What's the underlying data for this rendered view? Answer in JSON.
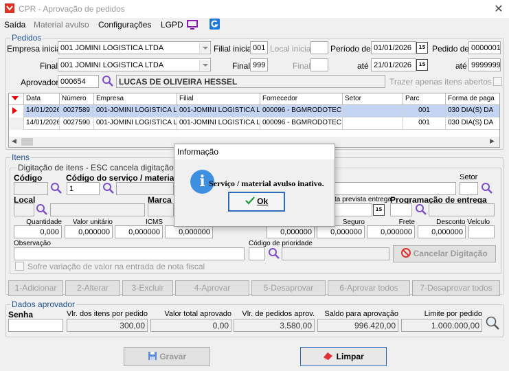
{
  "window": {
    "title": "CPR - Aprovação de pedidos"
  },
  "menu": {
    "items": [
      "Saída",
      "Material avulso",
      "Configurações",
      "LGPD"
    ]
  },
  "pedidos": {
    "group_label": "Pedidos",
    "empresa_inicial_label": "Empresa inicial",
    "empresa_inicial_value": "001 JOMINI LOGISTICA LTDA",
    "filial_inicial_label": "Filial inicial",
    "filial_inicial_value": "001",
    "local_inicial_label": "Local inicial",
    "periodo_label": "Período de",
    "periodo_de_value": "01/01/2026",
    "pedido_de_label": "Pedido de",
    "pedido_de_value": "0000001",
    "final_label": "Final",
    "empresa_final_value": "001 JOMINI LOGISTICA LTDA",
    "filial_final_label": "Final",
    "filial_final_value": "999",
    "local_final_label": "Final",
    "ate_label": "até",
    "periodo_ate_value": "21/01/2026",
    "pedido_ate_label": "até",
    "pedido_ate_value": "9999999",
    "aprovador_label": "Aprovador",
    "aprovador_code": "000654",
    "aprovador_name": "LUCAS DE OLIVEIRA HESSEL",
    "trazer_label": "Trazer apenas itens abertos",
    "calendar_glyph": "15",
    "table": {
      "columns": [
        "Data",
        "Número",
        "Empresa",
        "Filial",
        "Fornecedor",
        "Setor",
        "Parc",
        "Forma de paga"
      ],
      "rows": [
        [
          "14/01/2026",
          "0027589",
          "001-JOMINI LOGISTICA LT...",
          "001-JOMINI LOGISTICA LT...",
          "000096 - BGMRODOTEC",
          "",
          "001",
          "030 DIA(S) DA"
        ],
        [
          "14/01/2026",
          "0027590",
          "001-JOMINI LOGISTICA LT...",
          "001-JOMINI LOGISTICA LT...",
          "000096 - BGMRODOTEC",
          "",
          "001",
          "030 DIA(S) DA"
        ]
      ]
    }
  },
  "itens": {
    "group_label": "Itens",
    "digitacao_label": "Digitação de itens - ESC cancela digitação",
    "codigo_label": "Código",
    "servico_label": "Código do serviço / material av",
    "servico_value": "1",
    "setor_label": "Setor",
    "local_label": "Local",
    "marca_label": "Marca",
    "data_prevista_label": "ta prevista entrega",
    "programacao_label": "Programação de entrega",
    "value_headers": [
      "Quantidade",
      "Valor unitário",
      "ICMS",
      "",
      "",
      "Seguro",
      "Frete",
      "Desconto Veículo"
    ],
    "values": [
      "0,000",
      "0,000000",
      "0,000000",
      "0,000000",
      "0,000000",
      "0,000000",
      "0,000000",
      "0,000000"
    ],
    "observacao_label": "Observação",
    "prioridade_label": "Código de prioridade",
    "cancelar_label": "Cancelar Digitação",
    "sofre_label": "Sofre variação de valor na entrada de nota fiscal"
  },
  "actions": [
    "1-Adicionar",
    "2-Alterar",
    "3-Excluir",
    "4-Aprovar",
    "5-Desaprovar",
    "6-Aprovar todos",
    "7-Desaprovar todos"
  ],
  "dados": {
    "group_label": "Dados aprovador",
    "senha_label": "Senha",
    "headers": [
      "Vlr. dos itens por pedido",
      "Valor total aprovado",
      "Vlr. de pedidos aprov.",
      "Saldo para aprovação",
      "Limite por pedido"
    ],
    "values": [
      "300,00",
      "0,00",
      "3.580,00",
      "996.420,00",
      "1.000.000,00"
    ]
  },
  "footer": {
    "gravar_label": "Gravar",
    "limpar_label": "Limpar"
  },
  "dialog": {
    "title": "Informação",
    "message": "Serviço / material avulso inativo.",
    "ok_label": "Ok",
    "icon_glyph": "i"
  },
  "colors": {
    "accent": "#2f6bbd",
    "selection": "#c3d5f2",
    "group_label": "#1f4f8f"
  }
}
